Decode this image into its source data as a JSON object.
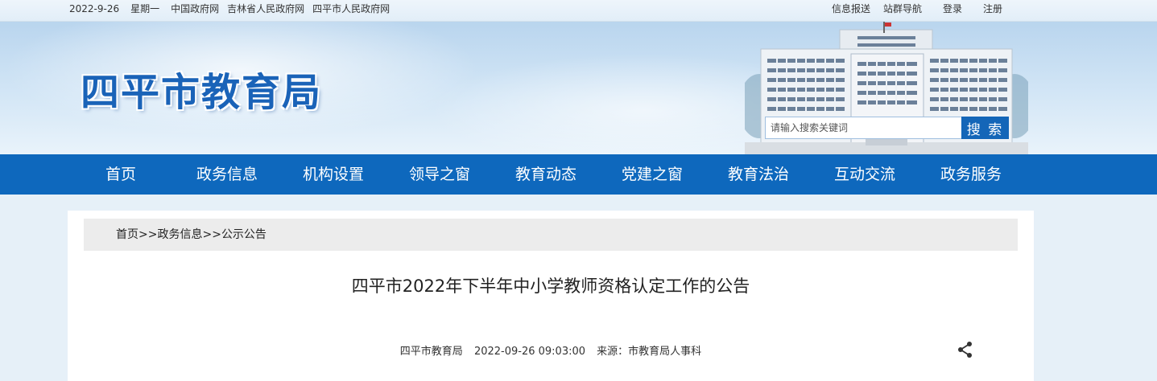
{
  "topbar": {
    "date": "2022-9-26",
    "weekday": "星期一",
    "links": [
      "中国政府网",
      "吉林省人民政府网",
      "四平市人民政府网"
    ],
    "right_links": [
      "信息报送",
      "站群导航",
      "登录",
      "注册"
    ]
  },
  "header": {
    "site_title": "四平市教育局",
    "search_placeholder": "请输入搜索关键词",
    "search_button": "搜 索"
  },
  "nav": {
    "items": [
      "首页",
      "政务信息",
      "机构设置",
      "领导之窗",
      "教育动态",
      "党建之窗",
      "教育法治",
      "互动交流",
      "政务服务"
    ]
  },
  "breadcrumb": {
    "home": "首页",
    "sep1": ">>",
    "level1": "政务信息",
    "sep2": ">>",
    "level2": "公示公告"
  },
  "article": {
    "title": "四平市2022年下半年中小学教师资格认定工作的公告",
    "publisher": "四平市教育局",
    "datetime": "2022-09-26 09:03:00",
    "source": "来源：市教育局人事科"
  },
  "colors": {
    "nav_bg": "#0e68bd",
    "title_blue": "#1a63b8",
    "search_btn": "#1466b8"
  },
  "icons": {
    "share": "share-icon"
  }
}
